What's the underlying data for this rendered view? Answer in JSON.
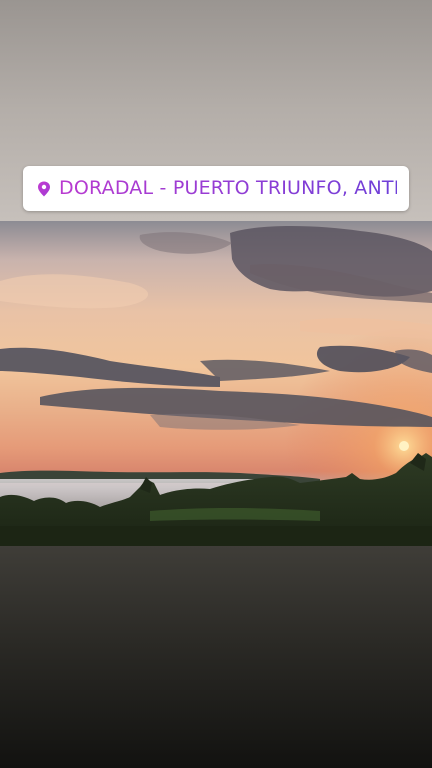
{
  "story": {
    "location_sticker": {
      "text": "DORADAL - PUERTO TRIUNFO, ANTIOQ...",
      "icon": "location-pin-icon",
      "text_gradient": [
        "#b93ad0",
        "#6e3fd8"
      ]
    },
    "photo": {
      "subject": "sunset-landscape-photo"
    },
    "colors": {
      "top_background": "#b4aea9",
      "bottom_background": "#2a2925"
    }
  }
}
